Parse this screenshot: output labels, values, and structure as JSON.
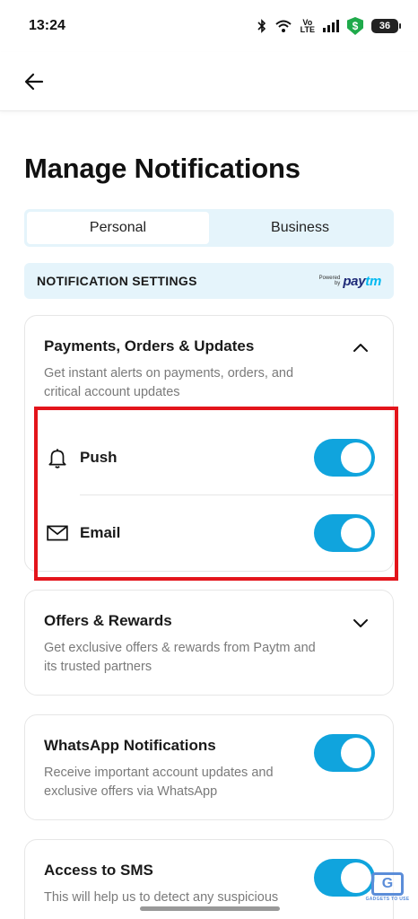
{
  "status_bar": {
    "time": "13:24",
    "volte_line1": "Vo",
    "volte_line2": "LTE",
    "shield_glyph": "$",
    "battery": "36"
  },
  "header": {
    "back_icon": "arrow-left-icon"
  },
  "page": {
    "title": "Manage Notifications"
  },
  "tabs": [
    {
      "label": "Personal",
      "active": true
    },
    {
      "label": "Business",
      "active": false
    }
  ],
  "section": {
    "title": "NOTIFICATION SETTINGS",
    "powered_line1": "Powered",
    "powered_line2": "by",
    "brand_left": "pay",
    "brand_right": "tm",
    "brand_colors": {
      "dark": "#1e2a78",
      "light": "#00b9f1"
    }
  },
  "cards": {
    "payments": {
      "title": "Payments, Orders & Updates",
      "description": "Get instant alerts on payments, orders, and critical account updates",
      "expanded": true,
      "rows": [
        {
          "icon": "bell-icon",
          "label": "Push",
          "enabled": true
        },
        {
          "icon": "mail-icon",
          "label": "Email",
          "enabled": true
        }
      ]
    },
    "offers": {
      "title": "Offers & Rewards",
      "description": "Get exclusive offers & rewards from Paytm and its trusted partners",
      "expanded": false
    },
    "whatsapp": {
      "title": "WhatsApp Notifications",
      "description": "Receive important account updates and exclusive offers via WhatsApp",
      "enabled": true
    },
    "sms": {
      "title": "Access to SMS",
      "description": "This will help us to detect any suspicious",
      "enabled": true
    }
  },
  "colors": {
    "accent": "#10a4dd",
    "highlight": "#e3141b",
    "tab_background": "#e5f4fb"
  },
  "watermark": {
    "glyph": "G",
    "text": "GADGETS TO USE"
  }
}
